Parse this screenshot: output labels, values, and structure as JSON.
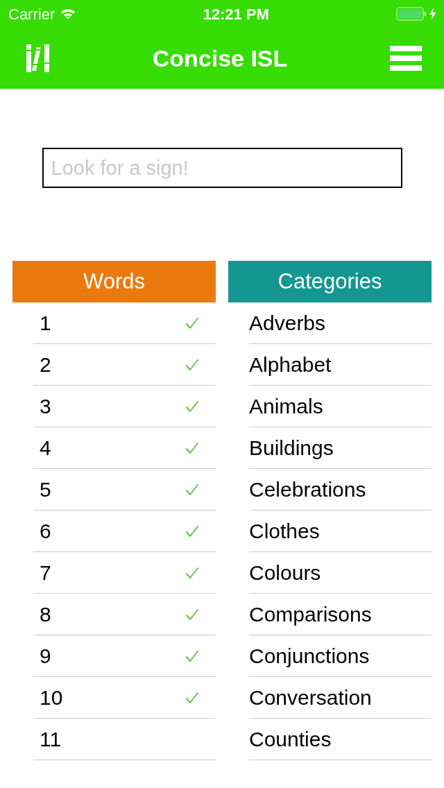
{
  "status_bar": {
    "carrier": "Carrier",
    "time": "12:21 PM"
  },
  "nav_bar": {
    "title": "Concise ISL"
  },
  "search": {
    "placeholder": "Look for a sign!"
  },
  "columns": [
    {
      "header": "Words",
      "color": "#eb7a0e",
      "rows": [
        {
          "label": "1",
          "checked": true
        },
        {
          "label": "2",
          "checked": true
        },
        {
          "label": "3",
          "checked": true
        },
        {
          "label": "4",
          "checked": true
        },
        {
          "label": "5",
          "checked": true
        },
        {
          "label": "6",
          "checked": true
        },
        {
          "label": "7",
          "checked": true
        },
        {
          "label": "8",
          "checked": true
        },
        {
          "label": "9",
          "checked": true
        },
        {
          "label": "10",
          "checked": true
        },
        {
          "label": "11",
          "checked": false
        }
      ]
    },
    {
      "header": "Categories",
      "color": "#149691",
      "rows": [
        {
          "label": "Adverbs"
        },
        {
          "label": "Alphabet"
        },
        {
          "label": "Animals"
        },
        {
          "label": "Buildings"
        },
        {
          "label": "Celebrations"
        },
        {
          "label": "Clothes"
        },
        {
          "label": "Colours"
        },
        {
          "label": "Comparisons"
        },
        {
          "label": "Conjunctions"
        },
        {
          "label": "Conversation"
        },
        {
          "label": "Counties"
        }
      ]
    }
  ]
}
